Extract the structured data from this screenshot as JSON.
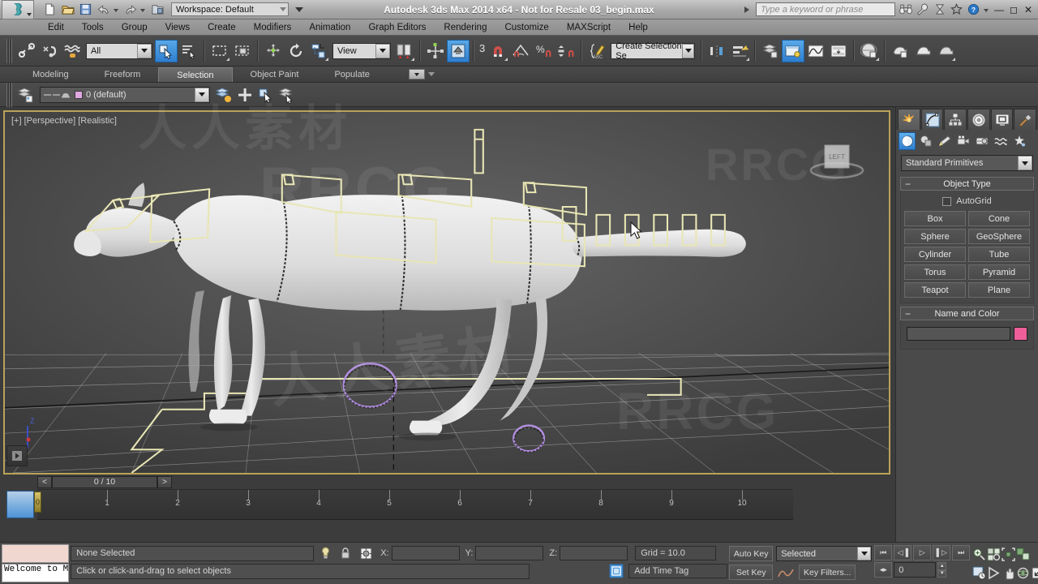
{
  "titlebar": {
    "app_title": "Autodesk 3ds Max  2014 x64  - Not for Resale   03_begin.max",
    "workspace_label": "Workspace: Default",
    "search_placeholder": "Type a keyword or phrase",
    "quick_access": [
      {
        "name": "new-file-icon",
        "glyph": "new"
      },
      {
        "name": "open-file-icon",
        "glyph": "open"
      },
      {
        "name": "save-file-icon",
        "glyph": "save"
      },
      {
        "name": "undo-icon",
        "glyph": "undo"
      },
      {
        "name": "redo-icon",
        "glyph": "redo"
      },
      {
        "name": "project-folder-icon",
        "glyph": "project"
      }
    ],
    "right_icons": [
      {
        "name": "binoculars-icon"
      },
      {
        "name": "wrench-icon"
      },
      {
        "name": "communication-center-icon"
      },
      {
        "name": "favorites-star-icon"
      },
      {
        "name": "help-icon"
      }
    ],
    "window_buttons": [
      "—",
      "▭",
      "✕"
    ]
  },
  "menubar": {
    "items": [
      "Edit",
      "Tools",
      "Group",
      "Views",
      "Create",
      "Modifiers",
      "Animation",
      "Graph Editors",
      "Rendering",
      "Customize",
      "MAXScript",
      "Help"
    ]
  },
  "main_toolbar": {
    "selection_filter": "All",
    "reference_coord": "View",
    "named_selection_sets": "Create Selection Se",
    "angle_snap_value": "3",
    "buttons": [
      {
        "name": "select-and-link-icon",
        "label": "Select and Link"
      },
      {
        "name": "unlink-selection-icon",
        "label": "Unlink Selection"
      },
      {
        "name": "bind-to-space-warp-icon",
        "label": "Bind to Space Warp"
      },
      {
        "name": "select-object-icon",
        "label": "Select Object",
        "active": true
      },
      {
        "name": "select-by-name-icon",
        "label": "Select by Name"
      },
      {
        "name": "rectangular-selection-region-icon",
        "label": "Rectangular Selection Region"
      },
      {
        "name": "window-crossing-icon",
        "label": "Window/Crossing"
      },
      {
        "name": "select-and-move-icon",
        "label": "Select and Move"
      },
      {
        "name": "select-and-rotate-icon",
        "label": "Select and Rotate"
      },
      {
        "name": "select-and-scale-icon",
        "label": "Select and Uniform Scale"
      },
      {
        "name": "use-center-flyout-icon",
        "label": "Use Pivot Point Center"
      },
      {
        "name": "select-and-manipulate-icon",
        "label": "Select and Manipulate",
        "active": true
      },
      {
        "name": "snaps-toggle-icon",
        "label": "Snaps Toggle"
      },
      {
        "name": "angle-snap-toggle-icon",
        "label": "Angle Snap Toggle"
      },
      {
        "name": "percent-snap-toggle-icon",
        "label": "Percent Snap Toggle"
      },
      {
        "name": "spinner-snap-toggle-icon",
        "label": "Spinner Snap Toggle"
      },
      {
        "name": "edit-named-selection-sets-icon",
        "label": "Edit Named Selection Sets"
      },
      {
        "name": "mirror-icon",
        "label": "Mirror"
      },
      {
        "name": "align-flyout-icon",
        "label": "Align"
      },
      {
        "name": "layer-manager-icon",
        "label": "Manage Layers"
      },
      {
        "name": "toggle-scene-explorer-icon",
        "label": "Toggle Scene Explorer",
        "active": true
      },
      {
        "name": "curve-editor-icon",
        "label": "Curve Editor"
      },
      {
        "name": "schematic-view-icon",
        "label": "Schematic View"
      },
      {
        "name": "material-editor-icon",
        "label": "Material Editor"
      },
      {
        "name": "render-setup-icon",
        "label": "Render Setup"
      },
      {
        "name": "rendered-frame-window-icon",
        "label": "Rendered Frame Window"
      },
      {
        "name": "render-production-icon",
        "label": "Render Production"
      }
    ]
  },
  "ribbon": {
    "tabs": [
      {
        "label": "Modeling",
        "active": false
      },
      {
        "label": "Freeform",
        "active": false
      },
      {
        "label": "Selection",
        "active": true
      },
      {
        "label": "Object Paint",
        "active": false
      },
      {
        "label": "Populate",
        "active": false
      }
    ]
  },
  "layer_toolbar": {
    "current_layer": "0 (default)",
    "layer_color": "#e0a8e0",
    "buttons": [
      {
        "name": "layer-explorer-icon"
      },
      {
        "name": "create-new-layer-icon"
      },
      {
        "name": "add-selection-to-layer-icon"
      },
      {
        "name": "select-objects-in-layer-icon"
      },
      {
        "name": "set-current-layer-icon"
      }
    ]
  },
  "viewport": {
    "label": "[+] [Perspective] [Realistic]",
    "viewcube_face": "LEFT",
    "axis_labels": {
      "z": "Z",
      "x": "X",
      "y": "Y"
    },
    "border_color": "#b9a35a",
    "rig_color": "#e8e6b4",
    "helper_purple": "#b28fe0",
    "helper_pink": "#e8917e",
    "content_description": "Rigged quadruped (feline) character with bone/helper gizmos in Perspective Realistic view"
  },
  "timeline": {
    "current_frame_display": "0 / 10",
    "prev_frame_symbol": "<",
    "next_frame_symbol": ">",
    "ticks": [
      "0",
      "1",
      "2",
      "3",
      "4",
      "5",
      "6",
      "7",
      "8",
      "9",
      "10"
    ],
    "playhead_frame": "0"
  },
  "command_panel": {
    "tabs": [
      {
        "name": "create-tab",
        "active": true
      },
      {
        "name": "modify-tab",
        "active": false
      },
      {
        "name": "hierarchy-tab",
        "active": false
      },
      {
        "name": "motion-tab",
        "active": false
      },
      {
        "name": "display-tab",
        "active": false
      },
      {
        "name": "utilities-tab",
        "active": false
      }
    ],
    "subtabs": [
      {
        "name": "geometry-subtab",
        "active": true
      },
      {
        "name": "shapes-subtab",
        "active": false
      },
      {
        "name": "lights-subtab",
        "active": false
      },
      {
        "name": "cameras-subtab",
        "active": false
      },
      {
        "name": "helpers-subtab",
        "active": false
      },
      {
        "name": "space-warps-subtab",
        "active": false
      },
      {
        "name": "systems-subtab",
        "active": false
      }
    ],
    "category": "Standard Primitives",
    "object_type": {
      "title": "Object Type",
      "autogrid_label": "AutoGrid",
      "autogrid_checked": false,
      "buttons": [
        "Box",
        "Cone",
        "Sphere",
        "GeoSphere",
        "Cylinder",
        "Tube",
        "Torus",
        "Pyramid",
        "Teapot",
        "Plane"
      ]
    },
    "name_and_color": {
      "title": "Name and Color",
      "name_value": "",
      "color": "#ee5f9a"
    }
  },
  "status_bar": {
    "maxscript_listener_text": "Welcome to M",
    "selection_status": "None Selected",
    "prompt": "Click or click-and-drag to select objects",
    "coord_labels": {
      "x": "X:",
      "y": "Y:",
      "z": "Z:"
    },
    "coord_values": {
      "x": "",
      "y": "",
      "z": ""
    },
    "grid": "Grid = 10.0",
    "add_time_tag": "Add Time Tag",
    "auto_key": "Auto Key",
    "set_key": "Set Key",
    "key_mode": "Selected",
    "key_filters": "Key Filters...",
    "current_frame": "0",
    "isolate_icon": "isolate-selection-icon",
    "lock_icon": "selection-lock-icon",
    "playback_buttons": [
      {
        "name": "go-to-start-button",
        "glyph": "⏮"
      },
      {
        "name": "previous-frame-button",
        "glyph": "◁▐"
      },
      {
        "name": "play-animation-button",
        "glyph": "▷"
      },
      {
        "name": "next-frame-button",
        "glyph": "▌▷"
      },
      {
        "name": "go-to-end-button",
        "glyph": "⏭"
      }
    ],
    "nav_buttons": [
      {
        "name": "zoom-icon"
      },
      {
        "name": "zoom-all-icon"
      },
      {
        "name": "zoom-extents-icon"
      },
      {
        "name": "zoom-extents-all-icon"
      },
      {
        "name": "field-of-view-icon"
      },
      {
        "name": "pan-view-icon"
      },
      {
        "name": "orbit-icon"
      },
      {
        "name": "maximize-viewport-toggle-icon"
      }
    ]
  },
  "watermarks": [
    "RRCG",
    "人人素材",
    "人人素材",
    "RRCG",
    "RRCG"
  ]
}
